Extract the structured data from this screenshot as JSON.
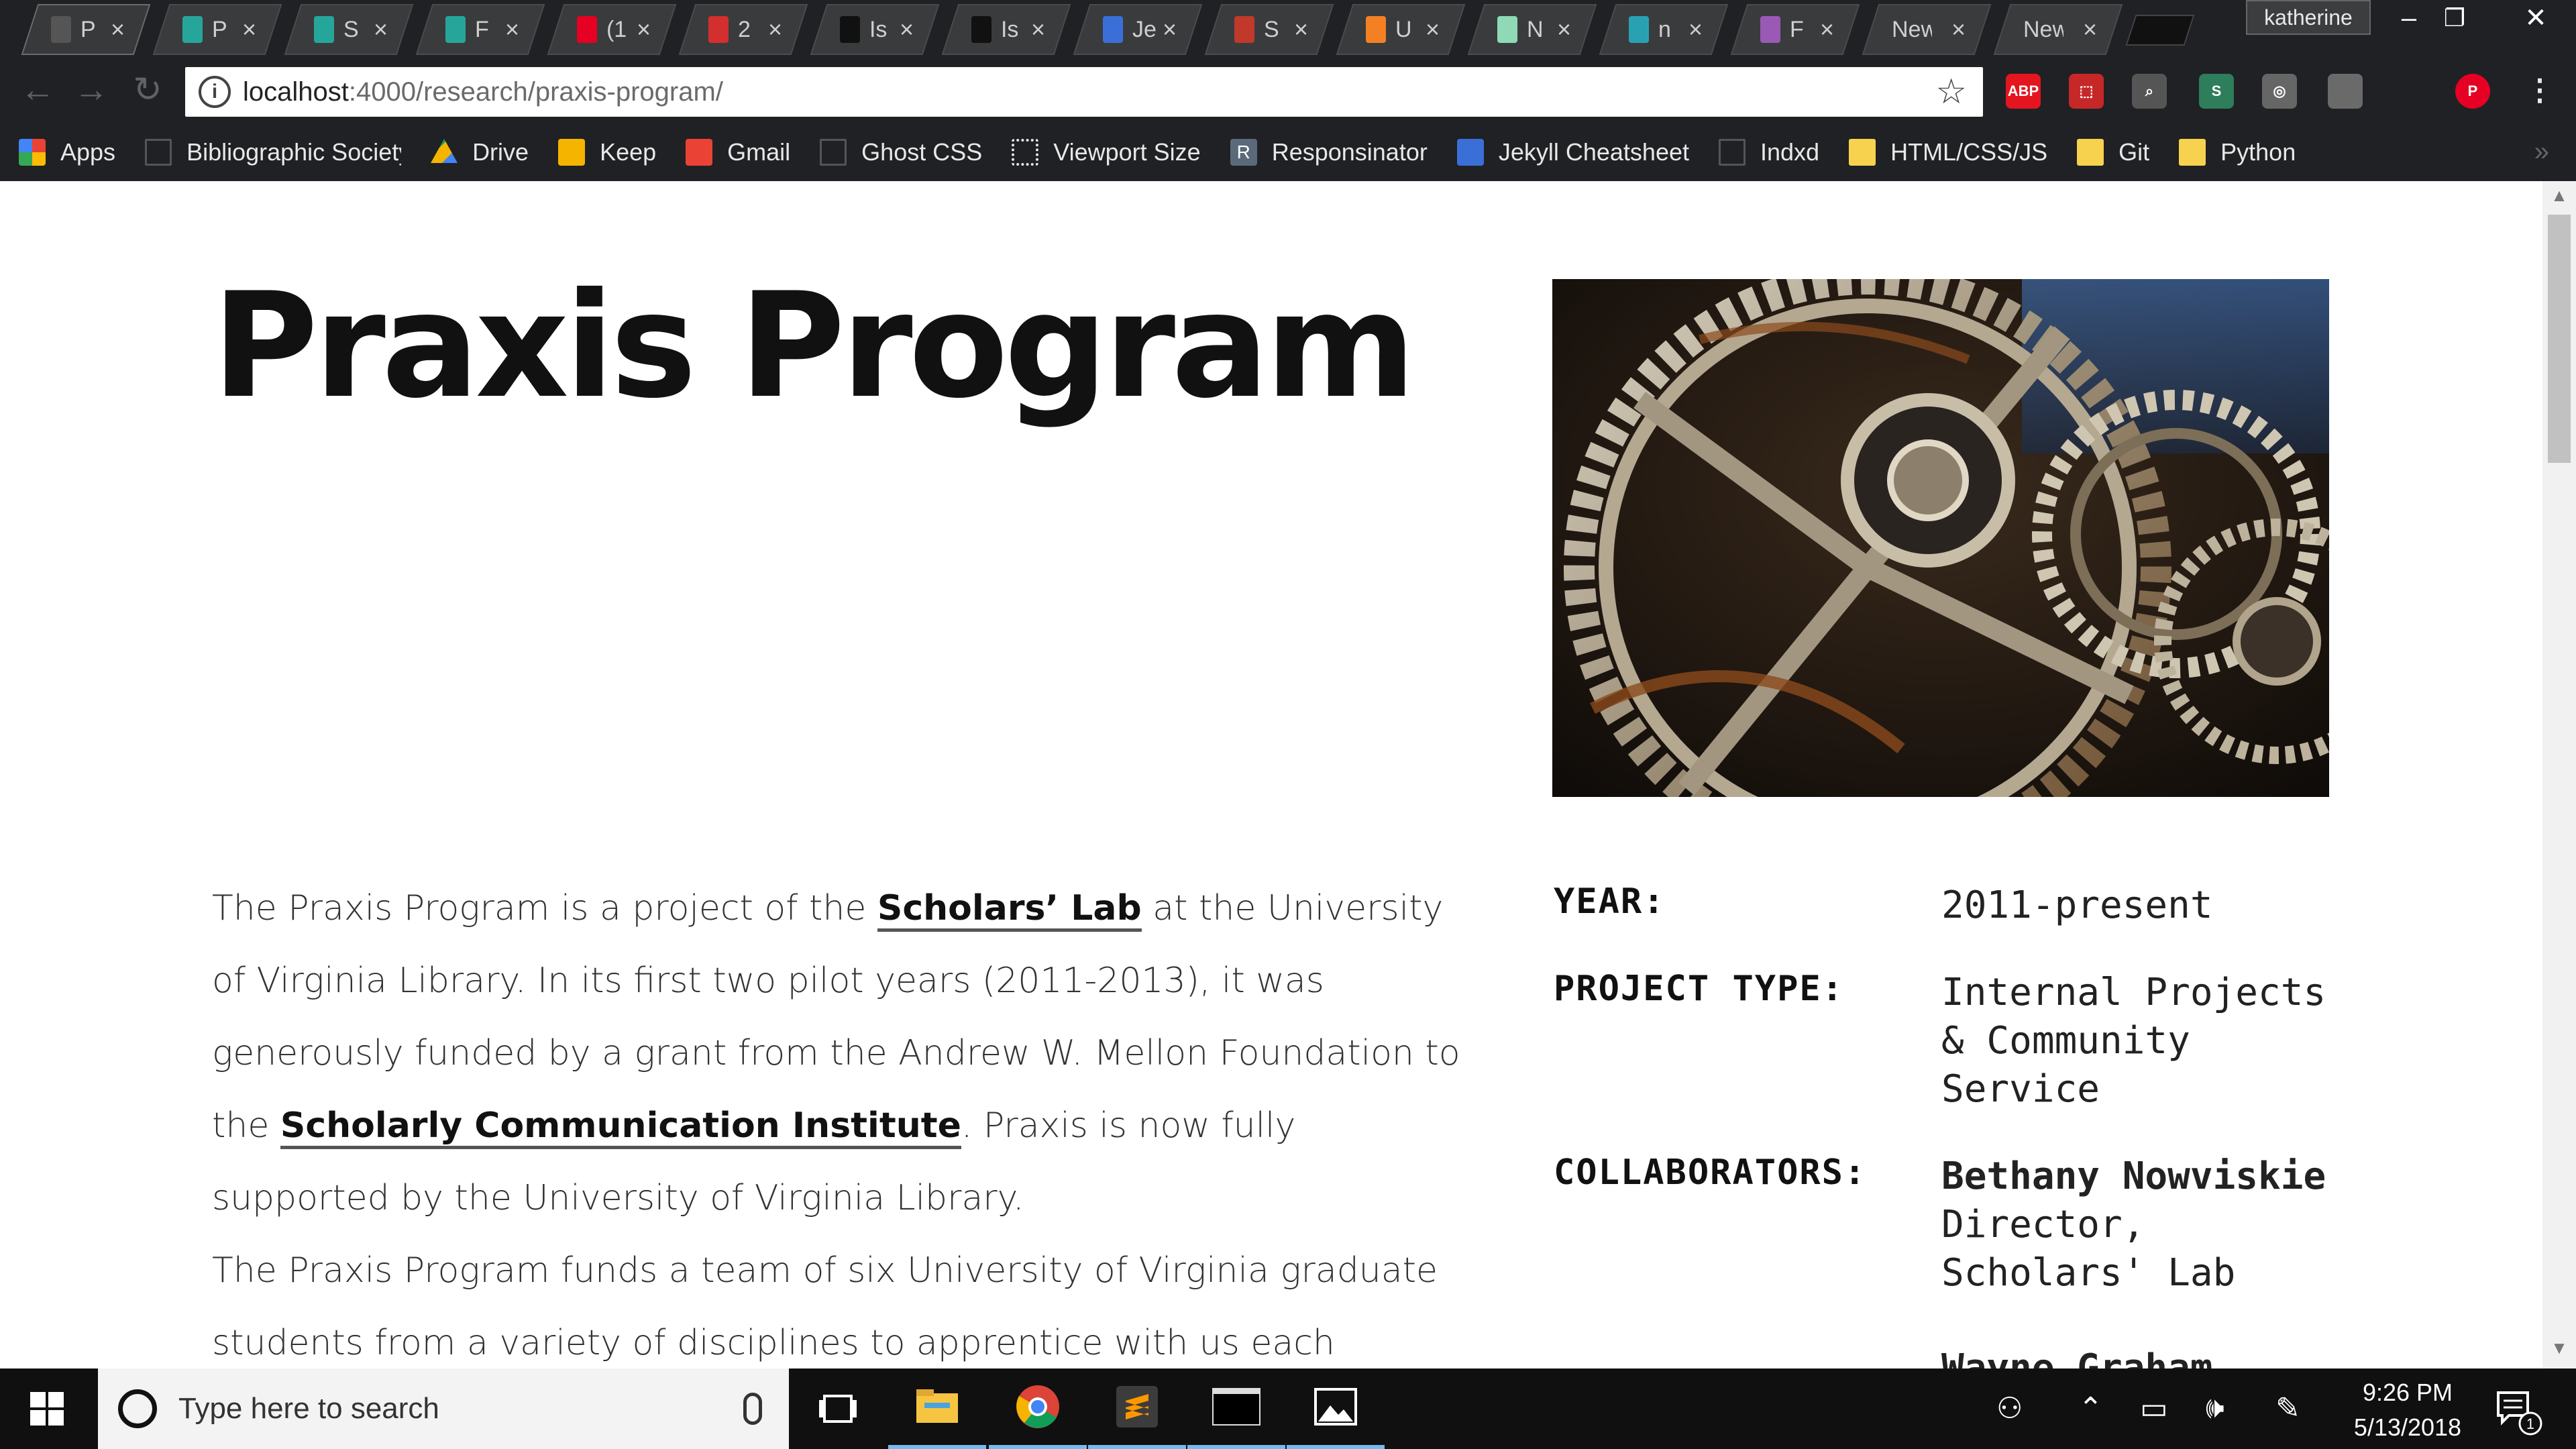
{
  "browser": {
    "tabs": [
      {
        "label": "P",
        "favicon": "page-icon",
        "color": "#555555",
        "active": true
      },
      {
        "label": "P",
        "favicon": "teal-square-icon",
        "color": "#26a69a"
      },
      {
        "label": "S",
        "favicon": "teal-square-icon",
        "color": "#26a69a"
      },
      {
        "label": "F",
        "favicon": "teal-square-icon",
        "color": "#26a69a"
      },
      {
        "label": "(1",
        "favicon": "pinterest-icon",
        "color": "#e60023"
      },
      {
        "label": "2",
        "favicon": "w-icon",
        "color": "#d32f2f"
      },
      {
        "label": "Is",
        "favicon": "github-icon",
        "color": "#111111"
      },
      {
        "label": "Is",
        "favicon": "github-icon",
        "color": "#111111"
      },
      {
        "label": "Je",
        "favicon": "blue-eye-icon",
        "color": "#3b6fd8"
      },
      {
        "label": "S",
        "favicon": "pencil-icon",
        "color": "#c0392b"
      },
      {
        "label": "U",
        "favicon": "stackoverflow-icon",
        "color": "#f48024"
      },
      {
        "label": "N",
        "favicon": "green-square-icon",
        "color": "#8fd9b6"
      },
      {
        "label": "n",
        "favicon": "teal-logo-icon",
        "color": "#2aa1b3"
      },
      {
        "label": "F",
        "favicon": "diamond-icon",
        "color": "#9b59b6"
      },
      {
        "label": "New",
        "favicon": "",
        "color": ""
      },
      {
        "label": "New",
        "favicon": "",
        "color": ""
      }
    ],
    "close_glyph": "×",
    "profile_name": "katherine",
    "window_buttons": {
      "minimize": "–",
      "restore": "❐",
      "close": "✕"
    },
    "address": {
      "host": "localhost",
      "path": ":4000/research/praxis-program/"
    },
    "extensions": [
      {
        "name": "adblock-icon",
        "label": "ABP",
        "color": "#e4151f"
      },
      {
        "name": "pdf-icon",
        "label": "⬚",
        "color": "#c62828"
      },
      {
        "name": "inspect-icon",
        "label": "⌕",
        "color": "#555555"
      },
      {
        "name": "s-extension-icon",
        "label": "S",
        "color": "#2e7d5b"
      },
      {
        "name": "lightbulb-icon",
        "label": "◎",
        "color": "#666666"
      },
      {
        "name": "grey-square-icon",
        "label": "",
        "color": "#6a6a6a"
      },
      {
        "name": "pinterest-icon",
        "label": "P",
        "color": "#e60023"
      }
    ],
    "bookmarks": [
      {
        "label": "Apps",
        "icon": "apps-icon",
        "kind": "apps"
      },
      {
        "label": "Bibliographic Society",
        "icon": "page-icon",
        "kind": "doc"
      },
      {
        "label": "Drive",
        "icon": "drive-icon",
        "kind": "drive"
      },
      {
        "label": "Keep",
        "icon": "keep-icon",
        "kind": "keep"
      },
      {
        "label": "Gmail",
        "icon": "gmail-icon",
        "kind": "gmail"
      },
      {
        "label": "Ghost CSS",
        "icon": "page-icon",
        "kind": "doc"
      },
      {
        "label": "Viewport Size",
        "icon": "viewport-icon",
        "kind": "viewport"
      },
      {
        "label": "Responsinator",
        "icon": "r-icon",
        "kind": "r"
      },
      {
        "label": "Jekyll Cheatsheet",
        "icon": "blue-eye-icon",
        "kind": "eye"
      },
      {
        "label": "Indxd",
        "icon": "page-icon",
        "kind": "doc"
      },
      {
        "label": "HTML/CSS/JS",
        "icon": "folder-icon",
        "kind": "folder"
      },
      {
        "label": "Git",
        "icon": "folder-icon",
        "kind": "folder"
      },
      {
        "label": "Python",
        "icon": "folder-icon",
        "kind": "folder"
      }
    ],
    "bookmarks_overflow": "»"
  },
  "page": {
    "title": "Praxis Program",
    "intro": {
      "p1": {
        "t1": "The Praxis Program is a project of the ",
        "link1": "Scholars’ Lab",
        "t2": " at the University of Virginia Library. In its first two pilot years (2011-2013), it was generously funded by a grant from the Andrew W. Mellon Foundation to the ",
        "link2": "Scholarly Communication Institute",
        "t3": ". Praxis is now fully supported by the University of Virginia Library."
      },
      "p2": "The Praxis Program funds a team of six University of Virginia graduate students from a variety of disciplines to apprentice with us each academic"
    },
    "meta": {
      "year_label": "YEAR:",
      "year_value": "2011-present",
      "type_label": "PROJECT TYPE:",
      "type_value": "Internal Projects & Community Service",
      "collab_label": "COLLABORATORS:",
      "collaborators": [
        {
          "name": "Bethany Nowviskie",
          "role": "Director, Scholars' Lab"
        },
        {
          "name": "Wayne Graham",
          "role": ""
        }
      ]
    }
  },
  "taskbar": {
    "search_placeholder": "Type here to search",
    "apps": [
      "task-view-icon",
      "file-explorer-icon",
      "chrome-icon",
      "sublime-text-icon",
      "terminal-icon",
      "photos-icon"
    ],
    "time": "9:26 PM",
    "date": "5/13/2018",
    "notification_count": "1"
  },
  "colors": {
    "link_underline": "#555555",
    "text": "#333333",
    "taskbar": "#101010"
  }
}
